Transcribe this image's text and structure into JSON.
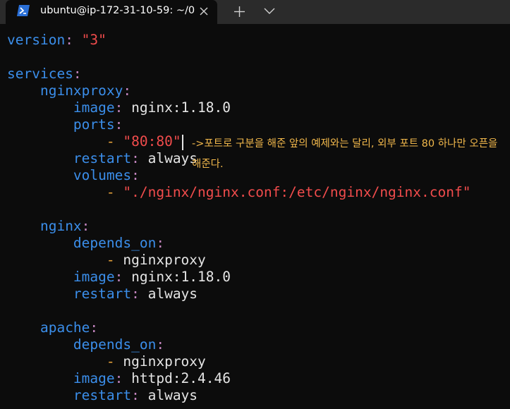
{
  "titlebar": {
    "tab_title": "ubuntu@ip-172-31-10-59: ~/0",
    "icon": "powershell-icon",
    "close_icon": "close-icon",
    "new_tab_icon": "plus-icon",
    "dropdown_icon": "chevron-down-icon"
  },
  "colors": {
    "key": "#3b8eea",
    "string": "#f14c4c",
    "value": "#e5e5e5",
    "punct": "#c586c0",
    "dash": "#e9a33a",
    "annotation": "#f2b84b"
  },
  "yaml": {
    "version_key": "version",
    "version_value": "\"3\"",
    "services_key": "services",
    "nginxproxy": {
      "key": "nginxproxy",
      "image_key": "image",
      "image_value": "nginx:1.18.0",
      "ports_key": "ports",
      "port_value": "\"80:80\"",
      "restart_key": "restart",
      "restart_value": "always",
      "volumes_key": "volumes",
      "volume_value": "\"./nginx/nginx.conf:/etc/nginx/nginx.conf\""
    },
    "nginx": {
      "key": "nginx",
      "depends_key": "depends_on",
      "depends_value": "nginxproxy",
      "image_key": "image",
      "image_value": "nginx:1.18.0",
      "restart_key": "restart",
      "restart_value": "always"
    },
    "apache": {
      "key": "apache",
      "depends_key": "depends_on",
      "depends_value": "nginxproxy",
      "image_key": "image",
      "image_value": "httpd:2.4.46",
      "restart_key": "restart",
      "restart_value": "always"
    }
  },
  "annotation": "->포트로 구분을 해준 앞의 예제와는 달리, 외부 포트 80 하나만 오픈을 해준다."
}
